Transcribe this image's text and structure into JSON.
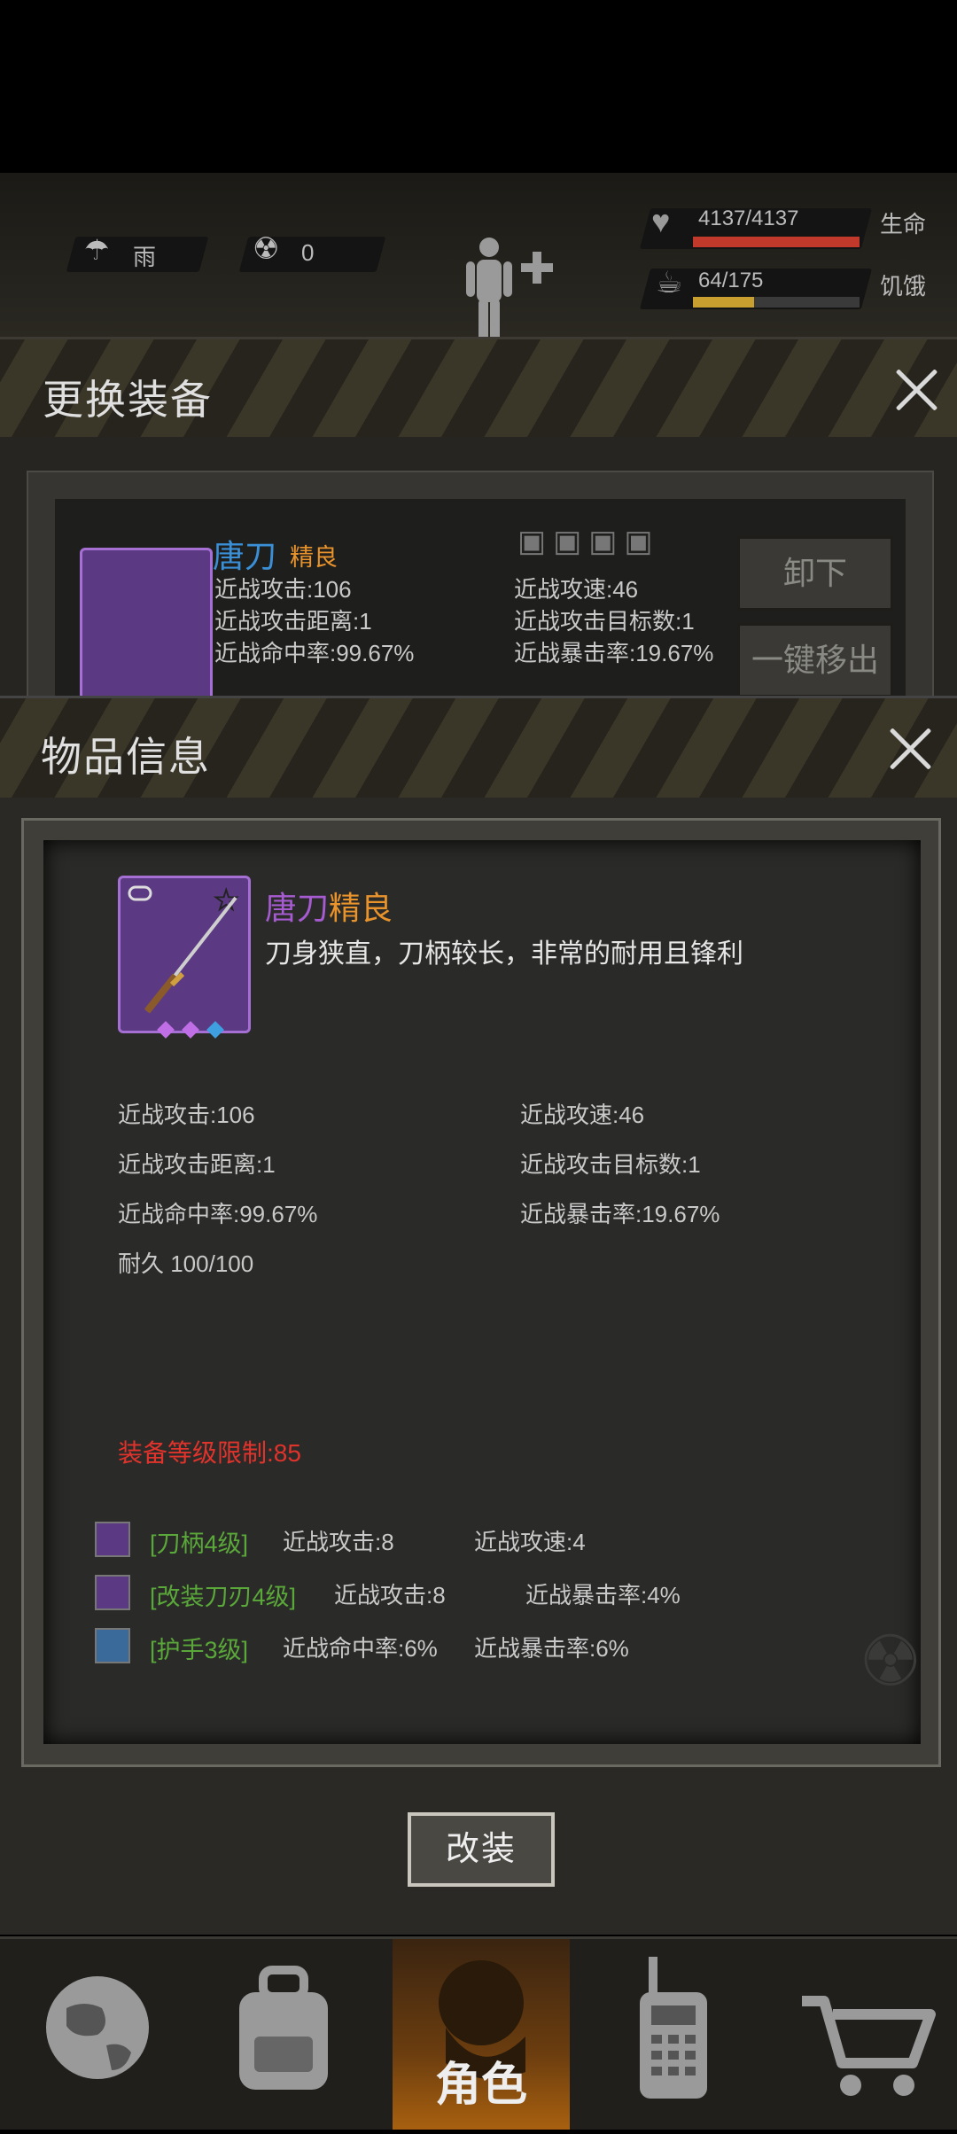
{
  "status": {
    "weather": "雨",
    "radiation": "0",
    "health": {
      "value": "4137/4137",
      "label": "生命",
      "fraction": 1.0
    },
    "hunger": {
      "value": "64/175",
      "label": "饥饿",
      "fraction": 0.366
    }
  },
  "equip_panel": {
    "title": "更换装备",
    "item_name": "唐刀",
    "item_quality": "精良",
    "stats": {
      "melee_attack": "近战攻击:106",
      "attack_speed": "近战攻速:46",
      "attack_range": "近战攻击距离:1",
      "target_count": "近战攻击目标数:1",
      "hit_rate": "近战命中率:99.67%",
      "crit_rate": "近战暴击率:19.67%"
    },
    "unequip_label": "卸下",
    "remove_all_label": "一键移出"
  },
  "item_info": {
    "title": "物品信息",
    "name": "唐刀",
    "quality": "精良",
    "description": "刀身狭直，刀柄较长，非常的耐用且锋利",
    "stats": {
      "melee_attack": "近战攻击:106",
      "attack_speed": "近战攻速:46",
      "attack_range": "近战攻击距离:1",
      "target_count": "近战攻击目标数:1",
      "hit_rate": "近战命中率:99.67%",
      "crit_rate": "近战暴击率:19.67%",
      "durability": "耐久 100/100"
    },
    "level_requirement": "装备等级限制:85",
    "mods": [
      {
        "name": "[刀柄4级]",
        "stat1": "近战攻击:8",
        "stat2": "近战攻速:4"
      },
      {
        "name": "[改装刀刃4级]",
        "stat1": "近战攻击:8",
        "stat2": "近战暴击率:4%"
      },
      {
        "name": "[护手3级]",
        "stat1": "近战命中率:6%",
        "stat2": "近战暴击率:6%"
      }
    ],
    "modify_button": "改装"
  },
  "nav": {
    "role_label": "角色"
  },
  "colors": {
    "quality_orange": "#e8932c",
    "name_purple": "#a65bd1",
    "equip_name_blue": "#3b8fd6",
    "requirement_red": "#e0332c",
    "mod_green": "#5aa83a",
    "health_red": "#c0392b",
    "hunger_yellow": "#c9a030"
  }
}
